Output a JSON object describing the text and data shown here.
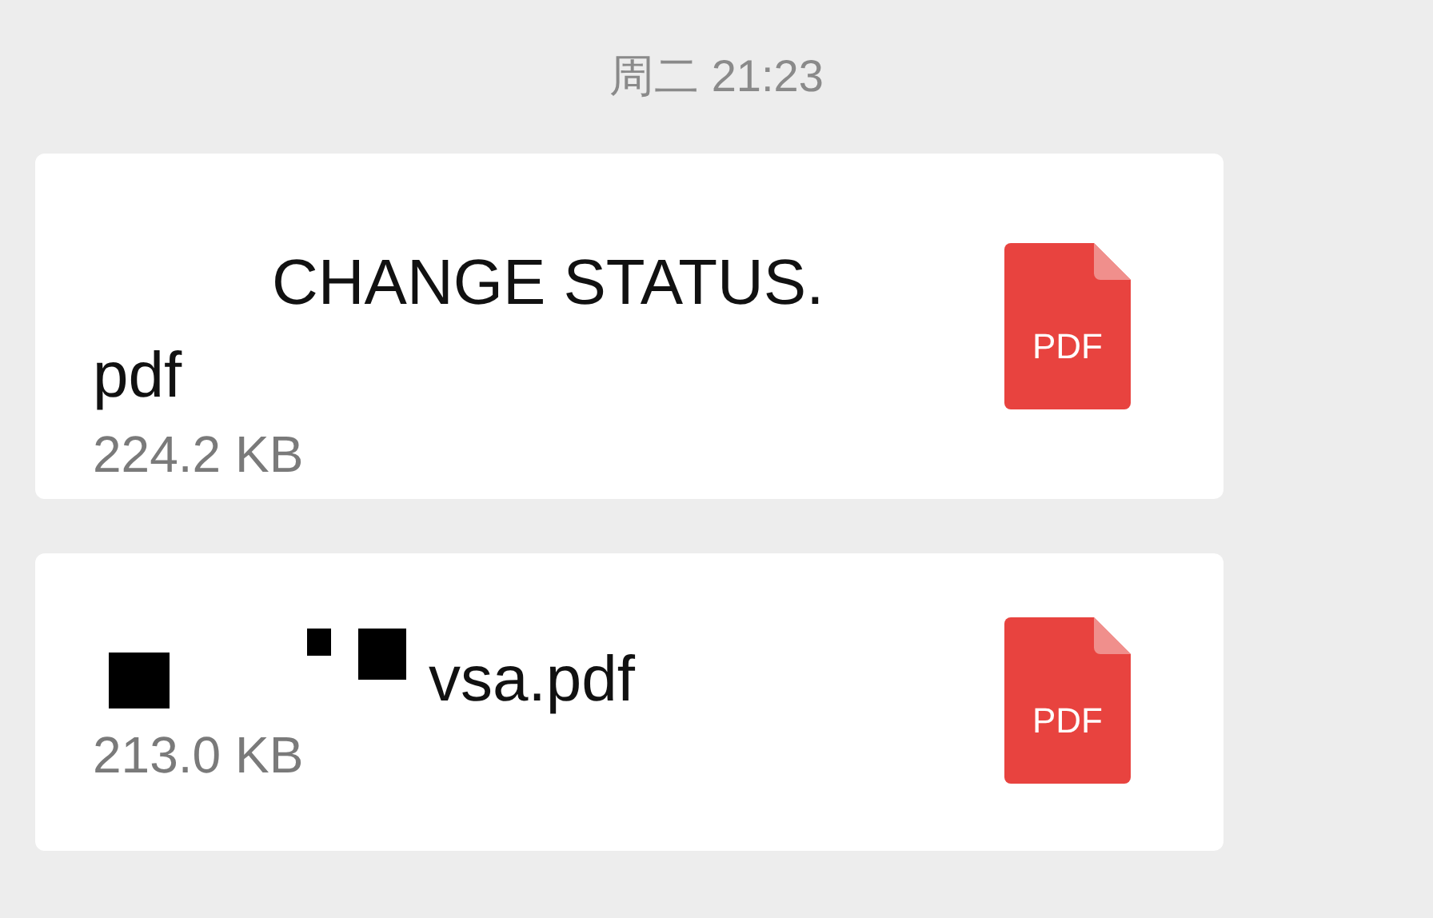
{
  "timestamp": "周二 21:23",
  "messages": [
    {
      "kind": "file",
      "name": "CHANGE STATUS.pdf",
      "size": "224.2 KB",
      "file_type": "PDF"
    },
    {
      "kind": "file",
      "name": "vsa.pdf",
      "size": "213.0 KB",
      "file_type": "PDF"
    }
  ]
}
